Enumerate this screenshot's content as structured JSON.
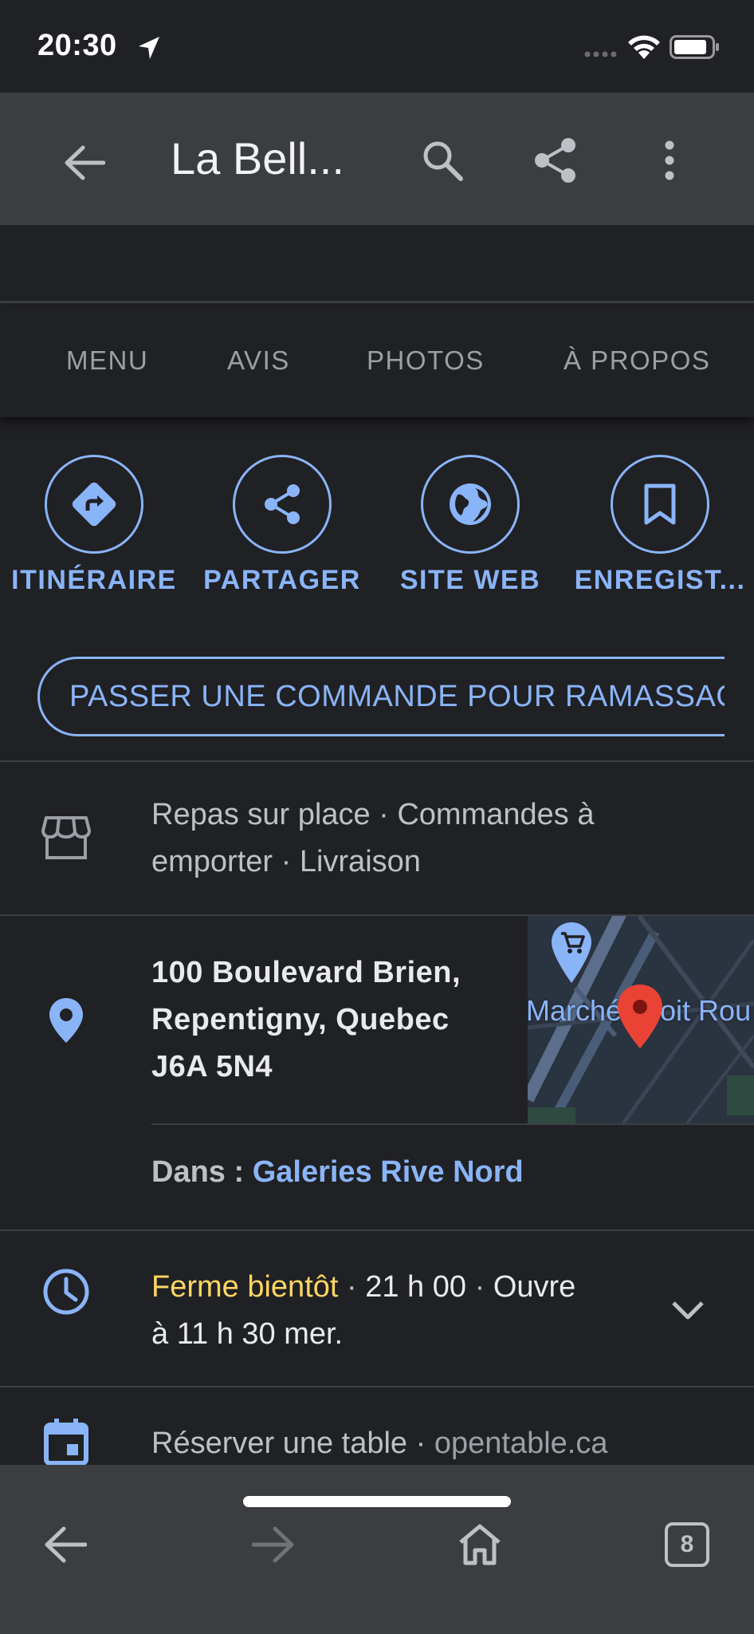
{
  "status_bar": {
    "time": "20:30"
  },
  "app_bar": {
    "title": "La Bell..."
  },
  "tabs": [
    {
      "label": "MENU"
    },
    {
      "label": "AVIS"
    },
    {
      "label": "PHOTOS"
    },
    {
      "label": "À PROPOS"
    }
  ],
  "actions": [
    {
      "label": "ITINÉRAIRE",
      "icon": "directions-icon"
    },
    {
      "label": "PARTAGER",
      "icon": "share-icon"
    },
    {
      "label": "SITE WEB",
      "icon": "globe-icon"
    },
    {
      "label": "ENREGIST...",
      "icon": "bookmark-icon"
    }
  ],
  "order_button": {
    "label": "PASSER UNE COMMANDE POUR RAMASSAGE"
  },
  "service_options": {
    "line1": "Repas sur place · Commandes à",
    "line2": "emporter · Livraison"
  },
  "address": {
    "line1": "100 Boulevard Brien,",
    "line2": "Repentigny, Quebec",
    "line3": "J6A 5N4"
  },
  "map": {
    "label": "Marché Droit Rou"
  },
  "located_in": {
    "prefix": "Dans : ",
    "link": "Galeries Rive Nord"
  },
  "hours": {
    "status": "Ferme bientôt",
    "sep1": " · ",
    "closing": "21 h 00",
    "sep2": " · ",
    "opens": "Ouvre",
    "line2": "à 11 h 30 mer."
  },
  "reservation": {
    "text": "Réserver une table",
    "sep": " · ",
    "provider": "opentable.ca"
  },
  "bottom_bar": {
    "tab_count": "8"
  },
  "colors": {
    "background": "#202124",
    "bar": "#3c3d40",
    "accent": "#8ab4f8",
    "warning": "#fdd663",
    "pin": "#ea4335"
  }
}
